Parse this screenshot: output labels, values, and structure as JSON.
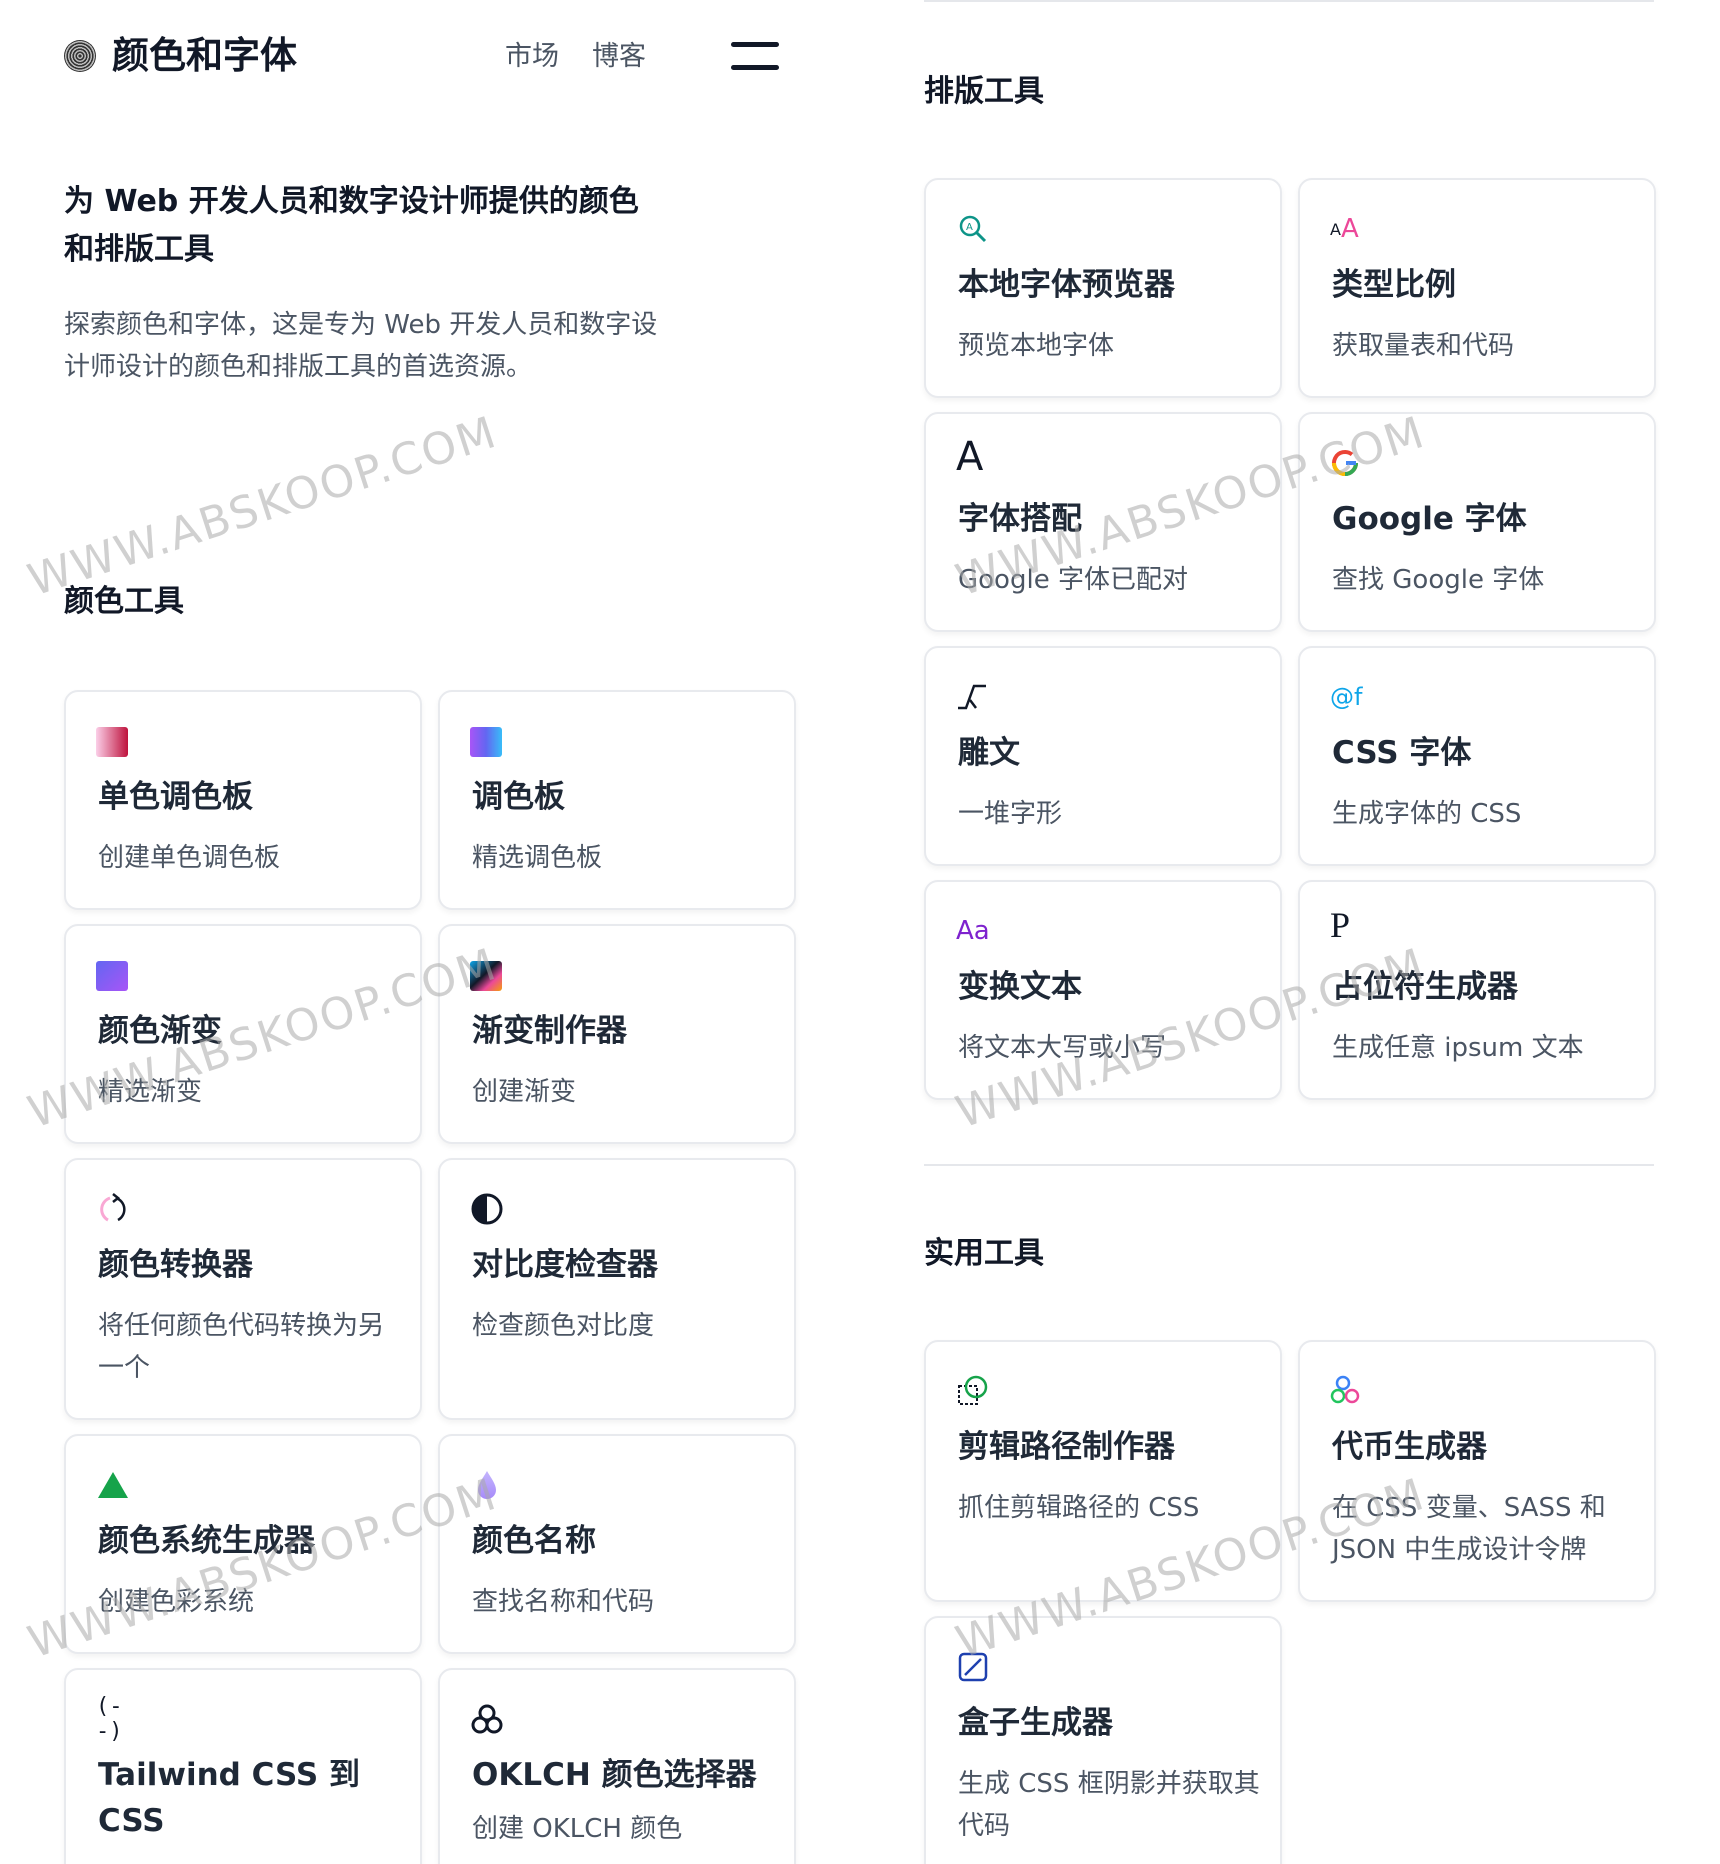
{
  "header": {
    "title": "颜色和字体",
    "nav": [
      "市场",
      "博客"
    ]
  },
  "hero": {
    "title": "为 Web 开发人员和数字设计师提供的颜色和排版工具",
    "description": "探索颜色和字体，这是专为 Web 开发人员和数字设计师设计的颜色和排版工具的首选资源。"
  },
  "color_tools": {
    "title": "颜色工具",
    "items": [
      {
        "icon": "swatch-pink-icon",
        "title": "单色调色板",
        "desc": "创建单色调色板"
      },
      {
        "icon": "swatch-purple-icon",
        "title": "调色板",
        "desc": "精选调色板"
      },
      {
        "icon": "gradient-square-icon",
        "title": "颜色渐变",
        "desc": "精选渐变"
      },
      {
        "icon": "gradient-maker-icon",
        "title": "渐变制作器",
        "desc": "创建渐变"
      },
      {
        "icon": "convert-icon",
        "title": "颜色转换器",
        "desc": "将任何颜色代码转换为另一个"
      },
      {
        "icon": "contrast-icon",
        "title": "对比度检查器",
        "desc": "检查颜色对比度"
      },
      {
        "icon": "triangle-icon",
        "title": "颜色系统生成器",
        "desc": "创建色彩系统"
      },
      {
        "icon": "droplet-icon",
        "title": "颜色名称",
        "desc": "查找名称和代码"
      },
      {
        "icon": "variable-icon",
        "icon_text": "(--)",
        "title": "Tailwind CSS 到 CSS",
        "desc": ""
      },
      {
        "icon": "circles-icon",
        "title": "OKLCH 颜色选择器",
        "desc": "创建 OKLCH 颜色"
      }
    ]
  },
  "typography_tools": {
    "title": "排版工具",
    "items": [
      {
        "icon": "search-font-icon",
        "title": "本地字体预览器",
        "desc": "预览本地字体"
      },
      {
        "icon": "type-scale-icon",
        "icon_text": "AA",
        "title": "类型比例",
        "desc": "获取量表和代码"
      },
      {
        "icon": "font-pair-icon",
        "icon_text": "A",
        "title": "字体搭配",
        "desc": "Google 字体已配对"
      },
      {
        "icon": "google-icon",
        "icon_text": "G",
        "title": "Google 字体",
        "desc": "查找 Google 字体"
      },
      {
        "icon": "glyph-icon",
        "title": "雕文",
        "desc": "一堆字形"
      },
      {
        "icon": "css-font-icon",
        "icon_text": "@f",
        "title": "CSS 字体",
        "desc": "生成字体的 CSS"
      },
      {
        "icon": "transform-text-icon",
        "icon_text": "Aa",
        "title": "变换文本",
        "desc": "将文本大写或小写"
      },
      {
        "icon": "placeholder-icon",
        "icon_text": "P",
        "title": "占位符生成器",
        "desc": "生成任意 ipsum 文本"
      }
    ]
  },
  "utility_tools": {
    "title": "实用工具",
    "items": [
      {
        "icon": "clip-path-icon",
        "title": "剪辑路径制作器",
        "desc": "抓住剪辑路径的 CSS"
      },
      {
        "icon": "tokens-icon",
        "title": "代币生成器",
        "desc": "在 CSS 变量、SASS 和 JSON 中生成设计令牌"
      },
      {
        "icon": "box-shadow-icon",
        "title": "盒子生成器",
        "desc": "生成 CSS 框阴影并获取其代码"
      }
    ]
  },
  "watermark": "WWW.ABSKOOP.COM"
}
